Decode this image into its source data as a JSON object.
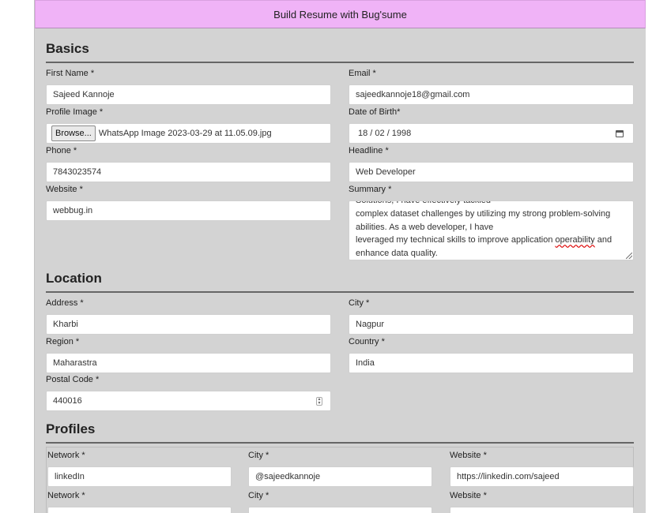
{
  "header": {
    "title": "Build Resume with Bug'sume"
  },
  "basics": {
    "title": "Basics",
    "first_name": {
      "label": "First Name *",
      "value": "Sajeed Kannoje"
    },
    "email": {
      "label": "Email *",
      "value": "sajeedkannoje18@gmail.com"
    },
    "profile_image": {
      "label": "Profile Image *",
      "button": "Browse...",
      "file_name": "WhatsApp Image 2023-03-29 at 11.05.09.jpg"
    },
    "dob": {
      "label": "Date of Birth*",
      "value": "18 / 02 / 1998",
      "icon": "calendar-icon"
    },
    "phone": {
      "label": "Phone *",
      "value": "7843023574"
    },
    "headline": {
      "label": "Headline *",
      "value": "Web Developer"
    },
    "website": {
      "label": "Website *",
      "value": "webbug.in"
    },
    "summary": {
      "label": "Summary *",
      "lines": [
        "Solutions, I have effectively tackled",
        "complex dataset challenges by utilizing my strong problem-solving",
        "abilities. As a web developer, I have",
        "leveraged my technical skills to improve application ",
        "operability",
        " and",
        "enhance data quality."
      ]
    }
  },
  "location": {
    "title": "Location",
    "address": {
      "label": "Address *",
      "value": "Kharbi"
    },
    "city": {
      "label": "City *",
      "value": "Nagpur"
    },
    "region": {
      "label": "Region *",
      "value": "Maharastra"
    },
    "country": {
      "label": "Country *",
      "value": "India"
    },
    "postal_code": {
      "label": "Postal Code *",
      "value": "440016",
      "icon": "spinner-icon"
    }
  },
  "profiles": {
    "title": "Profiles",
    "rows": [
      {
        "network": {
          "label": "Network *",
          "value": "linkedIn"
        },
        "city": {
          "label": "City *",
          "value": "@sajeedkannoje"
        },
        "website": {
          "label": "Website *",
          "value": "https://linkedin.com/sajeed"
        }
      },
      {
        "network": {
          "label": "Network *",
          "value": ""
        },
        "city": {
          "label": "City *",
          "value": ""
        },
        "website": {
          "label": "Website *",
          "value": ""
        }
      }
    ]
  }
}
